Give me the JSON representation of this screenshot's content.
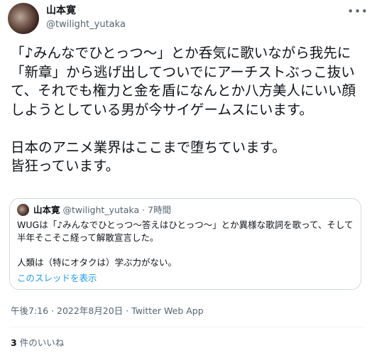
{
  "author": {
    "name": "山本寛",
    "handle": "@twilight_yutaka"
  },
  "menu_icon": "more-horizontal-icon",
  "tweet_text": "「♪みんなでひとっつ〜」とか呑気に歌いながら我先に「新章」から逃げ出してついでにアーチストぶっこ抜いて、それでも権力と金を盾になんとか八方美人にいい顔しようとしている男が今サイゲームスにいます。\n\n日本のアニメ業界はここまで堕ちています。\n皆狂っています。",
  "quote": {
    "name": "山本寛",
    "handle": "@twilight_yutaka",
    "separator": "·",
    "time": "7時間",
    "text": "WUGは「♪みんなでひとっつ〜答えはひとっつ〜」とか異様な歌詞を歌って、そして半年そこそこ経って解散宣言した。\n\n人類は（特にオタクは）学ぶ力がない。",
    "thread_link": "このスレッドを表示"
  },
  "meta": {
    "time": "午後7:16",
    "date": "2022年8月20日",
    "separator": "·",
    "source": "Twitter Web App"
  },
  "likes": {
    "count": "3",
    "label": "件のいいね"
  },
  "colors": {
    "text": "#0f1419",
    "secondary": "#536471",
    "link": "#1d9bf0",
    "border": "#cfd9de",
    "divider": "#eff3f4"
  }
}
